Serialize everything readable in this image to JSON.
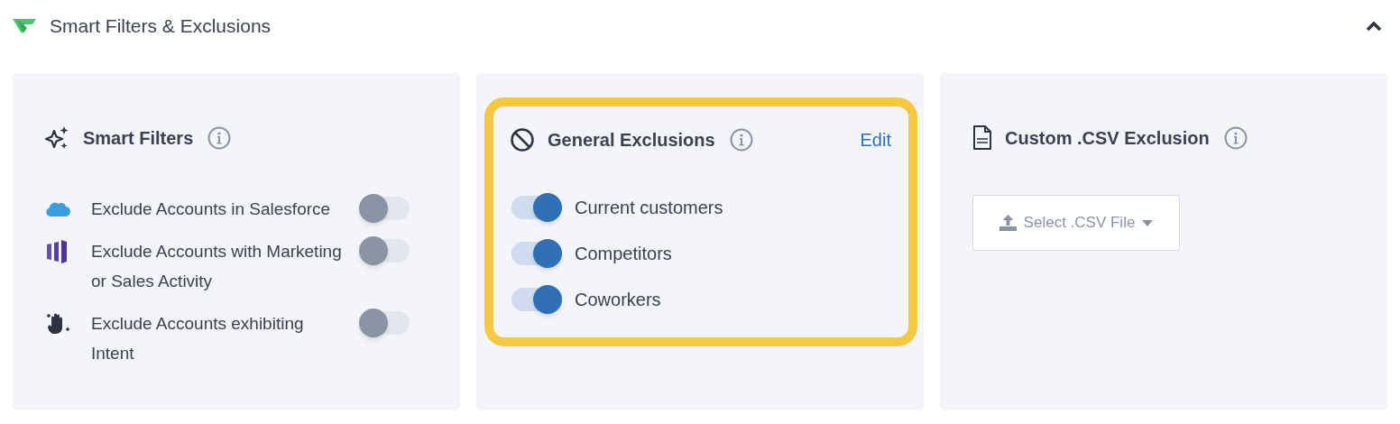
{
  "section": {
    "title": "Smart Filters & Exclusions",
    "expanded": true
  },
  "smart_filters": {
    "title": "Smart Filters",
    "items": [
      {
        "kind": "salesforce",
        "label": "Exclude Accounts in Salesforce",
        "on": false
      },
      {
        "kind": "marketing",
        "label": "Exclude Accounts with Marketing or Sales Activity",
        "on": false
      },
      {
        "kind": "intent",
        "label": "Exclude Accounts exhibiting Intent",
        "on": false
      }
    ]
  },
  "general_exclusions": {
    "title": "General Exclusions",
    "edit_link": "Edit",
    "highlighted": true,
    "items": [
      {
        "label": "Current customers",
        "on": true
      },
      {
        "label": "Competitors",
        "on": true
      },
      {
        "label": "Coworkers",
        "on": true
      }
    ]
  },
  "csv_exclusion": {
    "title": "Custom .CSV Exclusion",
    "button": "Select .CSV File"
  }
}
